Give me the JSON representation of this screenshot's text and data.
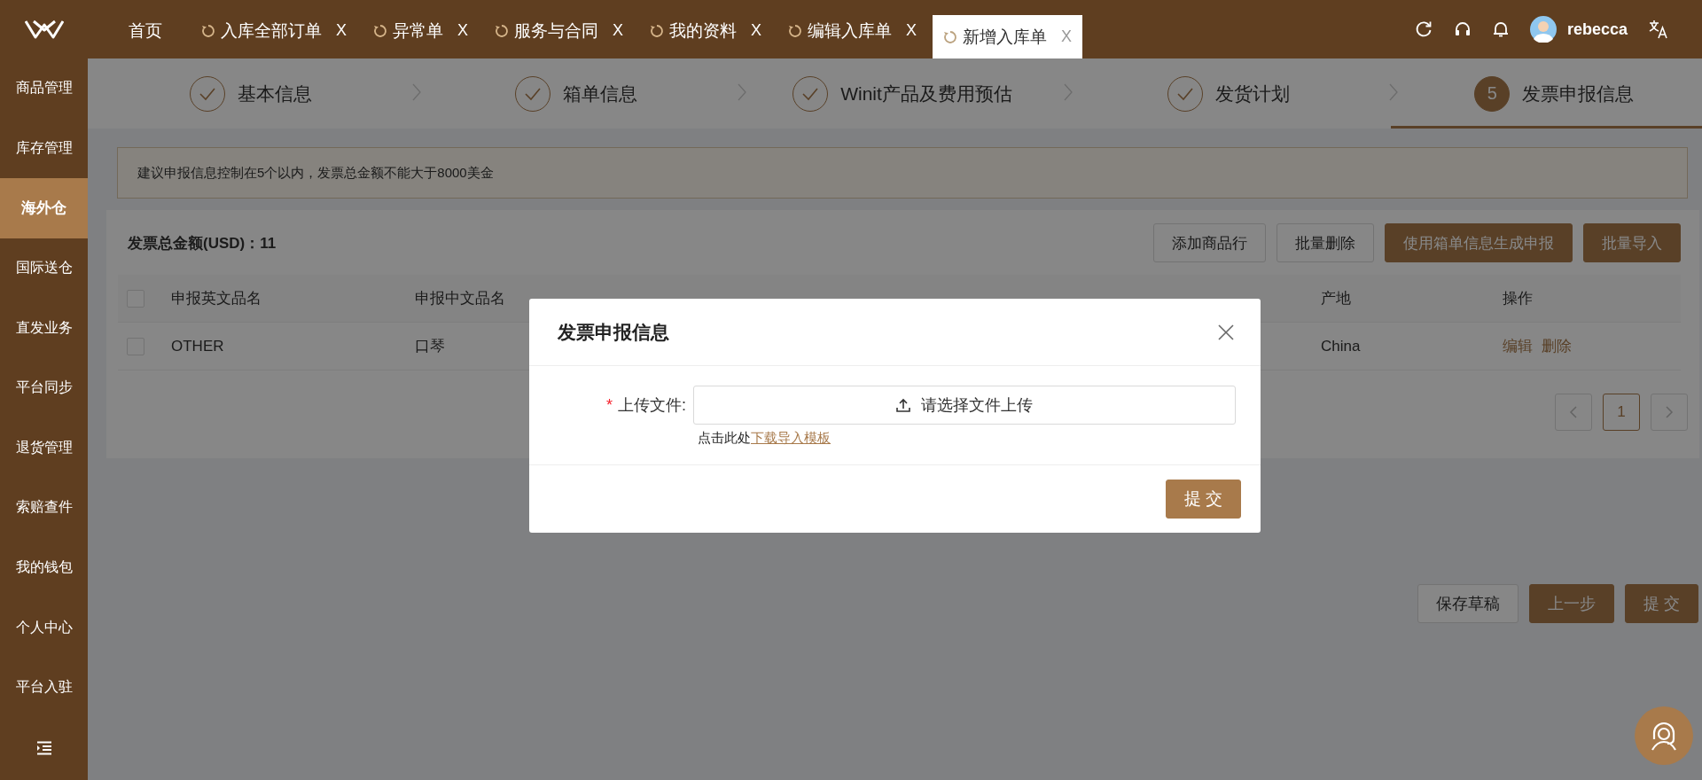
{
  "top_tabs": [
    {
      "label": "首页",
      "kind": "home",
      "selected": false
    },
    {
      "label": "入库全部订单",
      "kind": "page",
      "selected": false,
      "close": "X"
    },
    {
      "label": "异常单",
      "kind": "page",
      "selected": false,
      "close": "X"
    },
    {
      "label": "服务与合同",
      "kind": "page",
      "selected": false,
      "close": "X"
    },
    {
      "label": "我的资料",
      "kind": "page",
      "selected": false,
      "close": "X"
    },
    {
      "label": "编辑入库单",
      "kind": "page",
      "selected": false,
      "close": "X"
    },
    {
      "label": "新增入库单",
      "kind": "page",
      "selected": true,
      "close": "X"
    }
  ],
  "user": {
    "name": "rebecca"
  },
  "sidebar": {
    "items": [
      {
        "label": "商品管理",
        "selected": false
      },
      {
        "label": "库存管理",
        "selected": false
      },
      {
        "label": "海外仓",
        "selected": true
      },
      {
        "label": "国际送仓",
        "selected": false
      },
      {
        "label": "直发业务",
        "selected": false
      },
      {
        "label": "平台同步",
        "selected": false
      },
      {
        "label": "退货管理",
        "selected": false
      },
      {
        "label": "索赔查件",
        "selected": false
      },
      {
        "label": "我的钱包",
        "selected": false
      },
      {
        "label": "个人中心",
        "selected": false
      },
      {
        "label": "平台入驻",
        "selected": false
      }
    ]
  },
  "steps": [
    {
      "title": "基本信息",
      "kind": "done"
    },
    {
      "title": "箱单信息",
      "kind": "done"
    },
    {
      "title": "Winit产品及费用预估",
      "kind": "done"
    },
    {
      "title": "发货计划",
      "kind": "done"
    },
    {
      "title": "发票申报信息",
      "kind": "current",
      "number": "5"
    }
  ],
  "alert": "建议申报信息控制在5个以内，发票总金额不能大于8000美金",
  "total": "发票总金额(USD)：11",
  "toolbar_buttons": [
    {
      "label": "添加商品行",
      "kind": "default"
    },
    {
      "label": "批量删除",
      "kind": "default"
    },
    {
      "label": "使用箱单信息生成申报",
      "kind": "primary"
    },
    {
      "label": "批量导入",
      "kind": "primary"
    }
  ],
  "table": {
    "header_checked": false,
    "columns": [
      {
        "label": "申报英文品名"
      },
      {
        "label": "申报中文品名"
      },
      {
        "label": "产地"
      },
      {
        "label": "操作"
      }
    ],
    "rows": [
      {
        "checked": false,
        "english_name": "OTHER",
        "chinese_name": "口琴",
        "origin": "China",
        "actions": [
          "编辑",
          "删除"
        ]
      }
    ]
  },
  "pagination": {
    "pages": [
      {
        "label": "1",
        "selected": true
      }
    ]
  },
  "footer_buttons": [
    {
      "label": "保存草稿",
      "kind": "default"
    },
    {
      "label": "上一步",
      "kind": "primary"
    },
    {
      "label": "提 交",
      "kind": "primary"
    }
  ],
  "modal": {
    "title": "发票申报信息",
    "field": {
      "label": "上传文件:",
      "required_mark": "*",
      "button": "请选择文件上传"
    },
    "hint": "点击此处",
    "link": "下载导入模板",
    "submit": "提 交"
  }
}
